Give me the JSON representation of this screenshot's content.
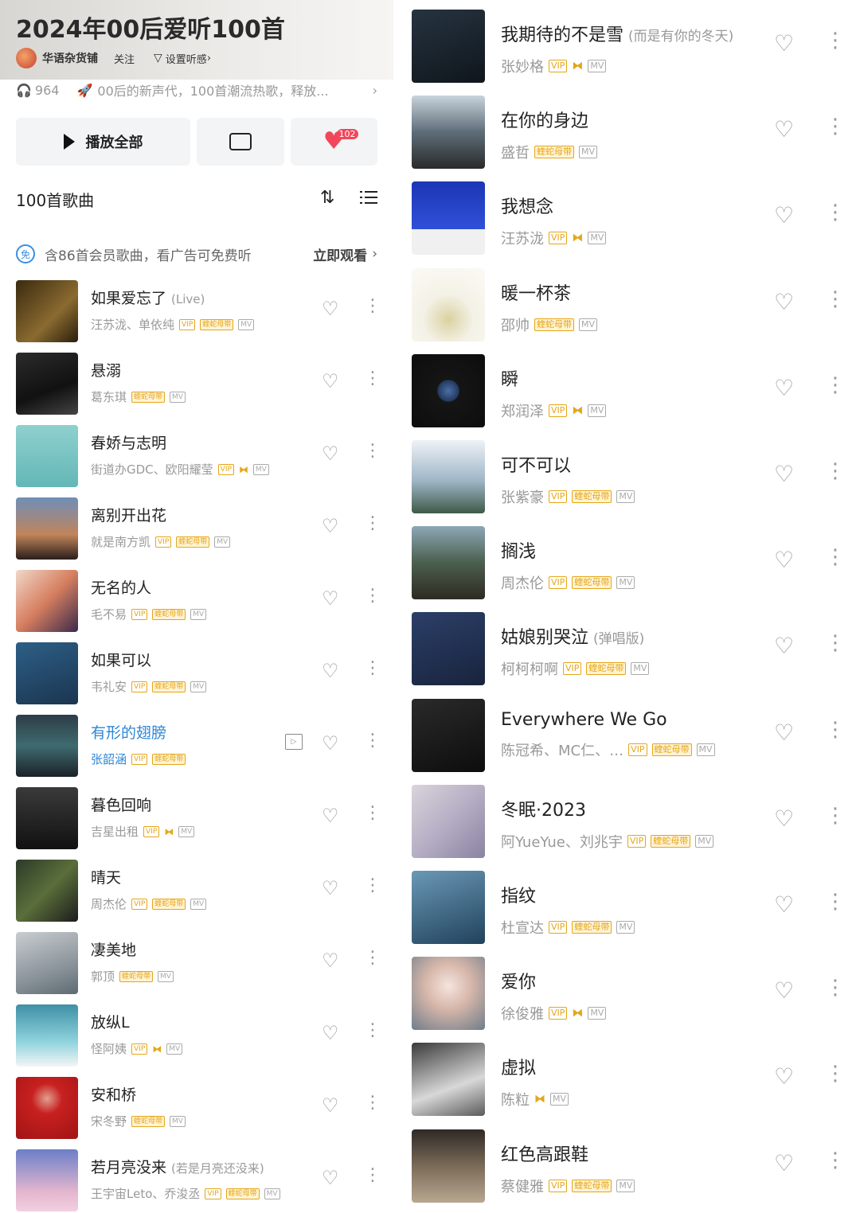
{
  "playlist": {
    "title": "2024年00后爱听100首",
    "creator": "华语杂货铺",
    "follow_label": "关注",
    "tune_label": "设置听感",
    "play_count": "964",
    "description": "00后的新声代，100首潮流热歌，释放...",
    "play_all_label": "播放全部",
    "fav_count": "102",
    "song_count_label": "100首歌曲",
    "banner_text": "含86首会员歌曲，看广告可免费听",
    "banner_action": "立即观看",
    "free_badge": "免"
  },
  "badges": {
    "vip": "VIP",
    "dl": "蝰蛇母带",
    "mv": "MV",
    "video": "▷"
  },
  "left_songs": [
    {
      "name": "如果爱忘了",
      "sub": "(Live)",
      "artist": "汪苏泷、单依纯",
      "badges": [
        "vip",
        "dl",
        "mv"
      ],
      "cover": "linear-gradient(135deg,#3a2a10,#8a6a30 60%,#2a1e0c)"
    },
    {
      "name": "悬溺",
      "sub": "",
      "artist": "葛东琪",
      "badges": [
        "dl",
        "mv"
      ],
      "cover": "linear-gradient(160deg,#2b2b2b,#111 60%,#444)"
    },
    {
      "name": "春娇与志明",
      "sub": "",
      "artist": "街道办GDC、欧阳耀莹",
      "badges": [
        "vip",
        "hq",
        "mv"
      ],
      "cover": "linear-gradient(180deg,#8fd0ce,#63b7b6)"
    },
    {
      "name": "离别开出花",
      "sub": "",
      "artist": "就是南方凯",
      "badges": [
        "vip",
        "dl",
        "mv"
      ],
      "cover": "linear-gradient(180deg,#6f8fb8,#c0845a 60%,#2a1e1a)"
    },
    {
      "name": "无名的人",
      "sub": "",
      "artist": "毛不易",
      "badges": [
        "vip",
        "dl",
        "mv"
      ],
      "cover": "linear-gradient(135deg,#f1d7c9,#d67e5f 50%,#3b2a4a)"
    },
    {
      "name": "如果可以",
      "sub": "",
      "artist": "韦礼安",
      "badges": [
        "vip",
        "dl",
        "mv"
      ],
      "cover": "linear-gradient(160deg,#2d5f86,#1b3550)"
    },
    {
      "name": "有形的翅膀",
      "sub": "",
      "artist": "张韶涵",
      "badges": [
        "vip",
        "dl"
      ],
      "cover": "linear-gradient(180deg,#2e3c46,#3e6b70 50%,#1b2228)",
      "playing": true
    },
    {
      "name": "暮色回响",
      "sub": "",
      "artist": "吉星出租",
      "badges": [
        "vip",
        "hq",
        "mv"
      ],
      "cover": "linear-gradient(180deg,#3a3a3a,#111)"
    },
    {
      "name": "晴天",
      "sub": "",
      "artist": "周杰伦",
      "badges": [
        "vip",
        "dl",
        "mv"
      ],
      "cover": "linear-gradient(135deg,#2c3a2a,#5a6e3a 50%,#1c1c1c)"
    },
    {
      "name": "凄美地",
      "sub": "",
      "artist": "郭顶",
      "badges": [
        "dl",
        "mv"
      ],
      "cover": "linear-gradient(160deg,#c9cdd0,#8c959c 60%,#5d6a72)"
    },
    {
      "name": "放纵L",
      "sub": "",
      "artist": "怪阿姨",
      "badges": [
        "vip",
        "hq",
        "mv"
      ],
      "cover": "linear-gradient(180deg,#3f8fa6,#8fd3dc 60%,#f3f5f5)"
    },
    {
      "name": "安和桥",
      "sub": "",
      "artist": "宋冬野",
      "badges": [
        "dl",
        "mv"
      ],
      "cover": "radial-gradient(circle at 50% 35%,#e0a090 0,#c82020 30%,#a01414 100%)"
    },
    {
      "name": "若月亮没来",
      "sub": "(若是月亮还没来)",
      "artist": "王宇宙Leto、乔浚丞",
      "badges": [
        "vip",
        "dl",
        "mv"
      ],
      "cover": "linear-gradient(180deg,#6b7fc8,#e6b7cf 70%,#f0d0e0)"
    }
  ],
  "right_songs": [
    {
      "name": "我期待的不是雪",
      "sub": "(而是有你的冬天)",
      "artist": "张妙格",
      "badges": [
        "vip",
        "hq",
        "mv"
      ],
      "cover": "linear-gradient(160deg,#263340,#0f161c)"
    },
    {
      "name": "在你的身边",
      "sub": "",
      "artist": "盛哲",
      "badges": [
        "dl",
        "mv"
      ],
      "cover": "linear-gradient(180deg,#c9d4dc,#5d6d78 50%,#2a2a2a)"
    },
    {
      "name": "我想念",
      "sub": "",
      "artist": "汪苏泷",
      "badges": [
        "vip",
        "hq",
        "mv"
      ],
      "cover": "linear-gradient(180deg,#1c36b4 0,#3050d8 65%,#f0f0f0 65%,#f0f0f0 100%)"
    },
    {
      "name": "暖一杯茶",
      "sub": "",
      "artist": "邵帅",
      "badges": [
        "dl",
        "mv"
      ],
      "cover": "radial-gradient(circle at 50% 70%,#d9d2a0 0,#f4f1e6 40%,#fbfaf6 100%)"
    },
    {
      "name": "瞬",
      "sub": "",
      "artist": "郑润泽",
      "badges": [
        "vip",
        "hq",
        "mv"
      ],
      "cover": "radial-gradient(circle at 50% 50%,#4a6fa8 0,#243a5e 20%,#151515 22%,#0d0d0d 100%)"
    },
    {
      "name": "可不可以",
      "sub": "",
      "artist": "张紫豪",
      "badges": [
        "vip",
        "dl",
        "mv"
      ],
      "cover": "linear-gradient(180deg,#eef2f6,#9fb6c8 55%,#3f5a48)"
    },
    {
      "name": "搁浅",
      "sub": "",
      "artist": "周杰伦",
      "badges": [
        "vip",
        "dl",
        "mv"
      ],
      "cover": "linear-gradient(180deg,#8da7b6,#4b5f4e 50%,#2e2a22)"
    },
    {
      "name": "姑娘别哭泣",
      "sub": "(弹唱版)",
      "artist": "柯柯柯啊",
      "badges": [
        "vip",
        "dl",
        "mv"
      ],
      "cover": "linear-gradient(160deg,#2c3f68,#18243d)"
    },
    {
      "name": "Everywhere We Go",
      "sub": "",
      "artist": "陈冠希、MC仁、…",
      "badges": [
        "vip",
        "dl",
        "mv"
      ],
      "cover": "linear-gradient(160deg,#2a2a2a,#0d0d0d)"
    },
    {
      "name": "冬眠·2023",
      "sub": "",
      "artist": "阿YueYue、刘兆宇",
      "badges": [
        "vip",
        "dl",
        "mv"
      ],
      "cover": "linear-gradient(135deg,#d9d4dc,#b6aec4 50%,#8a83a3)"
    },
    {
      "name": "指纹",
      "sub": "",
      "artist": "杜宣达",
      "badges": [
        "vip",
        "dl",
        "mv"
      ],
      "cover": "linear-gradient(160deg,#6a98b6,#21425c)"
    },
    {
      "name": "爱你",
      "sub": "",
      "artist": "徐俊雅",
      "badges": [
        "vip",
        "hq",
        "mv"
      ],
      "cover": "radial-gradient(circle at 50% 40%,#f5e4de 0,#d7b7aa 40%,#6f7c8a 100%)"
    },
    {
      "name": "虚拟",
      "sub": "",
      "artist": "陈粒",
      "badges": [
        "hq",
        "mv"
      ],
      "cover": "linear-gradient(160deg,#3a3a3a,#d8d8d8 60%,#5a5a5a)"
    },
    {
      "name": "红色高跟鞋",
      "sub": "",
      "artist": "蔡健雅",
      "badges": [
        "vip",
        "dl",
        "mv"
      ],
      "cover": "linear-gradient(180deg,#2f2a26,#7a6a58 50%,#b8a891)"
    }
  ]
}
